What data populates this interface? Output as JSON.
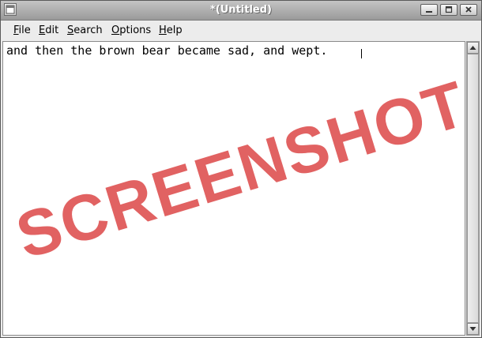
{
  "window": {
    "title": "*(Untitled)"
  },
  "menu": {
    "items": [
      {
        "mnemonic": "F",
        "rest": "ile"
      },
      {
        "mnemonic": "E",
        "rest": "dit"
      },
      {
        "mnemonic": "S",
        "rest": "earch"
      },
      {
        "mnemonic": "O",
        "rest": "ptions"
      },
      {
        "mnemonic": "H",
        "rest": "elp"
      }
    ]
  },
  "editor": {
    "text": "and then the brown bear became sad, and wept."
  },
  "watermark": {
    "text": "SCREENSHOT",
    "color": "#dc4646"
  },
  "icons": {
    "window_menu": "window-menu-icon",
    "minimize": "minimize-icon",
    "maximize": "maximize-icon",
    "close": "close-icon",
    "scroll_up": "arrow-up-icon",
    "scroll_down": "arrow-down-icon"
  }
}
